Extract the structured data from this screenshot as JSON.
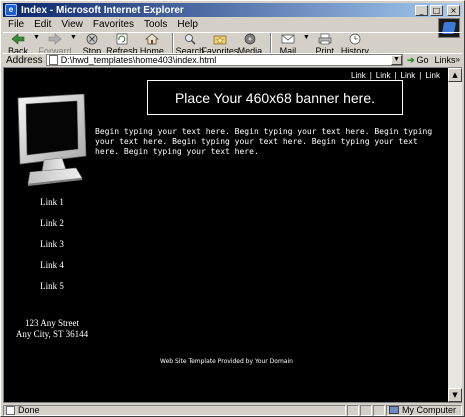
{
  "window": {
    "title": "Index - Microsoft Internet Explorer",
    "minimize_glyph": "_",
    "maximize_glyph": "□",
    "close_glyph": "×"
  },
  "menu": [
    "File",
    "Edit",
    "View",
    "Favorites",
    "Tools",
    "Help"
  ],
  "toolbar": {
    "back": "Back",
    "forward": "Forward",
    "stop": "Stop",
    "refresh": "Refresh",
    "home": "Home",
    "search": "Search",
    "favorites": "Favorites",
    "media": "Media",
    "mail": "Mail",
    "print": "Print",
    "history": "History"
  },
  "address": {
    "label": "Address",
    "url": "D:\\hwd_templates\\home403\\index.html",
    "go": "Go",
    "links": "Links"
  },
  "page": {
    "top_links": [
      "Link",
      "Link",
      "Link",
      "Link"
    ],
    "top_link_separator": "|",
    "banner": "Place Your 460x68 banner here.",
    "body_text": "Begin typing your text here. Begin typing your text here. Begin typing your text here. Begin typing your text here. Begin typing your text here. Begin typing your text here.",
    "side_links": [
      "Link 1",
      "Link 2",
      "Link 3",
      "Link 4",
      "Link 5"
    ],
    "address_line1": "123 Any Street",
    "address_line2": "Any City, ST 36144",
    "footer": "Web Site Template Provided by Your Domain"
  },
  "status": {
    "text": "Done",
    "zone": "My Computer"
  },
  "colors": {
    "titlebar_start": "#0a246a",
    "titlebar_end": "#a6caf0",
    "chrome": "#d4d0c8",
    "page_background": "#000000",
    "page_text": "#ffffff"
  }
}
